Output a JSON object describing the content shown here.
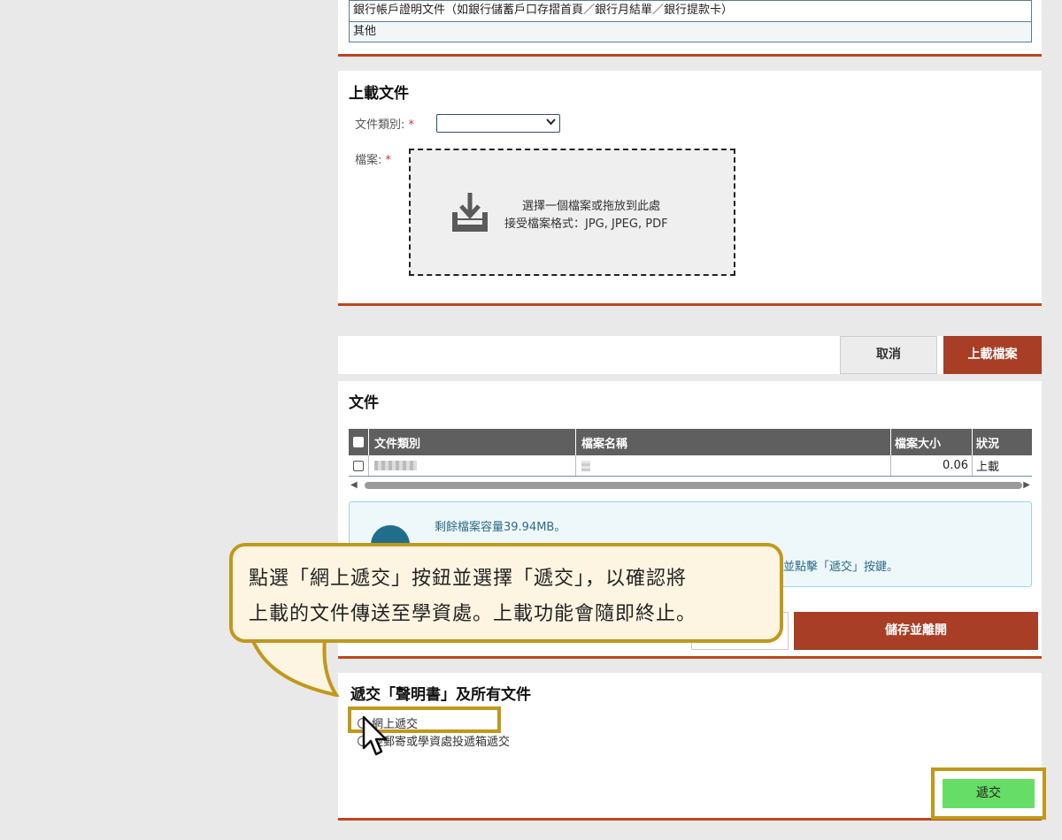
{
  "doc_type_list": {
    "rows": [
      "銀行帳戶證明文件（如銀行儲蓄戶口存摺首頁／銀行月結單／銀行提款卡）",
      "其他"
    ]
  },
  "upload": {
    "title": "上載文件",
    "doc_type_label": "文件類別:",
    "file_label": "檔案:",
    "required_mark": "*",
    "dropzone_line1": "選擇一個檔案或拖放到此處",
    "dropzone_line2": "接受檔案格式：JPG, JPEG, PDF",
    "icon": "upload-tray-icon"
  },
  "action_bar": {
    "cancel_label": "取消",
    "upload_label": "上載檔案"
  },
  "files": {
    "title": "文件",
    "columns": [
      "文件類別",
      "檔案名稱",
      "檔案大小",
      "狀況"
    ],
    "rows": [
      {
        "type": "",
        "name": "",
        "size": "0.06",
        "status": "上載"
      }
    ],
    "info_text1": "剩餘檔案容量39.94MB。",
    "info_text2": "並點擊「遞交」按鍵。",
    "save_exit_label": "儲存並離開"
  },
  "submit": {
    "title": "遞交「聲明書」及所有文件",
    "option_online": "網上遞交",
    "option_mail": "經郵寄或學資處投遞箱遞交",
    "submit_label": "遞交"
  },
  "callout": {
    "line1": "點選「網上遞交」按鈕並選擇「遞交」，以確認將",
    "line2": "上載的文件傳送至學資處。上載功能會隨即終止。"
  },
  "colors": {
    "accent": "#c0441f",
    "primary_button": "#a83e25",
    "submit_button": "#66dd66",
    "highlight": "#c1981a",
    "info_bg": "#eef8fb"
  }
}
